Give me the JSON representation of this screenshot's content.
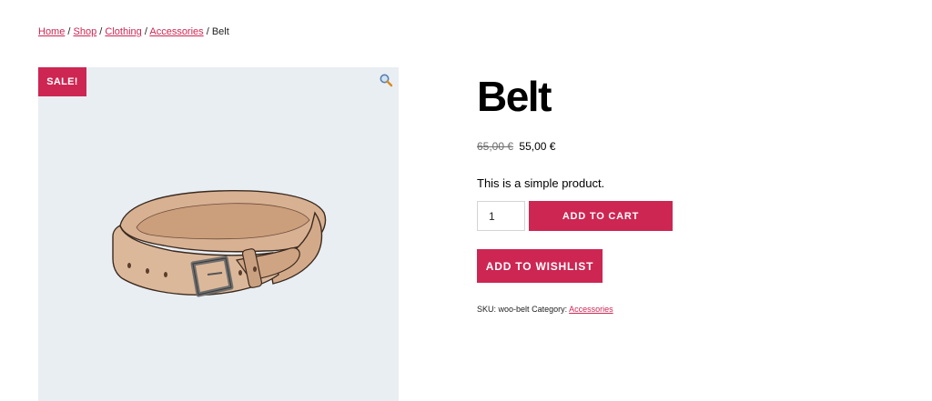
{
  "breadcrumb": {
    "items": [
      "Home",
      "Shop",
      "Clothing",
      "Accessories"
    ],
    "separator": "/",
    "current": "Belt"
  },
  "gallery": {
    "sale_badge": "SALE!",
    "zoom_icon": "magnifier-icon",
    "image_alt": "belt"
  },
  "product": {
    "title": "Belt",
    "old_price": "65,00 €",
    "price": "55,00 €",
    "short_description": "This is a simple product.",
    "quantity": "1",
    "add_to_cart_label": "ADD TO CART",
    "wishlist_label": "ADD TO WISHLIST"
  },
  "meta": {
    "sku_label": "SKU:",
    "sku_value": "woo-belt",
    "category_label": "Category:",
    "category_value": "Accessories"
  },
  "colors": {
    "accent": "#cd2653",
    "gallery_bg": "#e9eef3"
  }
}
